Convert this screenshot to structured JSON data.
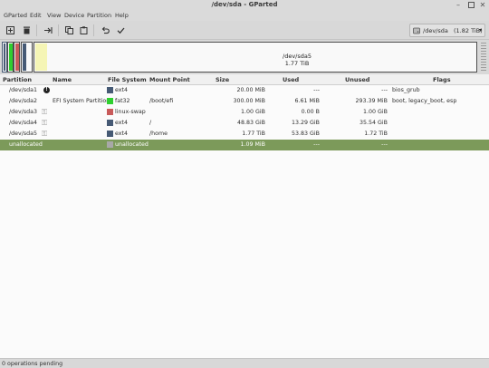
{
  "window": {
    "title": "/dev/sda - GParted"
  },
  "menu": [
    "GParted",
    "Edit",
    "View",
    "Device",
    "Partition",
    "Help"
  ],
  "toolbar": {
    "buttons": [
      "new-icon",
      "delete-icon",
      "resize-icon",
      "copy-icon",
      "paste-icon",
      "undo-icon",
      "apply-icon"
    ],
    "device": {
      "name": "/dev/sda",
      "size": "(1.82 TiB)"
    }
  },
  "map": {
    "selected_label": "/dev/sda5",
    "selected_size": "1.77 TiB",
    "colors": {
      "boot": "#2fcf2f",
      "swap": "#c85a5a",
      "ext4": "#465a75",
      "used": "#f5f5b5"
    }
  },
  "table": {
    "headers": [
      "Partition",
      "Name",
      "File System",
      "Mount Point",
      "Size",
      "Used",
      "Unused",
      "Flags"
    ],
    "rows": [
      {
        "partition": "/dev/sda1",
        "name": "",
        "icon": "warning",
        "fs": "ext4",
        "color": "#465a75",
        "mount": "",
        "size": "20.00 MiB",
        "used": "---",
        "unused": "---",
        "flags": "bios_grub"
      },
      {
        "partition": "/dev/sda2",
        "name": "EFI System Partition",
        "icon": "",
        "fs": "fat32",
        "color": "#2fcf2f",
        "mount": "/boot/efi",
        "size": "300.00 MiB",
        "used": "6.61 MiB",
        "unused": "293.39 MiB",
        "flags": "boot, legacy_boot, esp"
      },
      {
        "partition": "/dev/sda3",
        "name": "",
        "icon": "key",
        "fs": "linux-swap",
        "color": "#c85a5a",
        "mount": "",
        "size": "1.00 GiB",
        "used": "0.00 B",
        "unused": "1.00 GiB",
        "flags": ""
      },
      {
        "partition": "/dev/sda4",
        "name": "",
        "icon": "key",
        "fs": "ext4",
        "color": "#465a75",
        "mount": "/",
        "size": "48.83 GiB",
        "used": "13.29 GiB",
        "unused": "35.54 GiB",
        "flags": ""
      },
      {
        "partition": "/dev/sda5",
        "name": "",
        "icon": "key",
        "fs": "ext4",
        "color": "#465a75",
        "mount": "/home",
        "size": "1.77 TiB",
        "used": "53.83 GiB",
        "unused": "1.72 TiB",
        "flags": ""
      },
      {
        "partition": "unallocated",
        "name": "",
        "icon": "",
        "fs": "unallocated",
        "color": "#a8a8a8",
        "mount": "",
        "size": "1.09 MiB",
        "used": "---",
        "unused": "---",
        "flags": "",
        "selected": true
      }
    ]
  },
  "status": {
    "text": "0 operations pending"
  }
}
